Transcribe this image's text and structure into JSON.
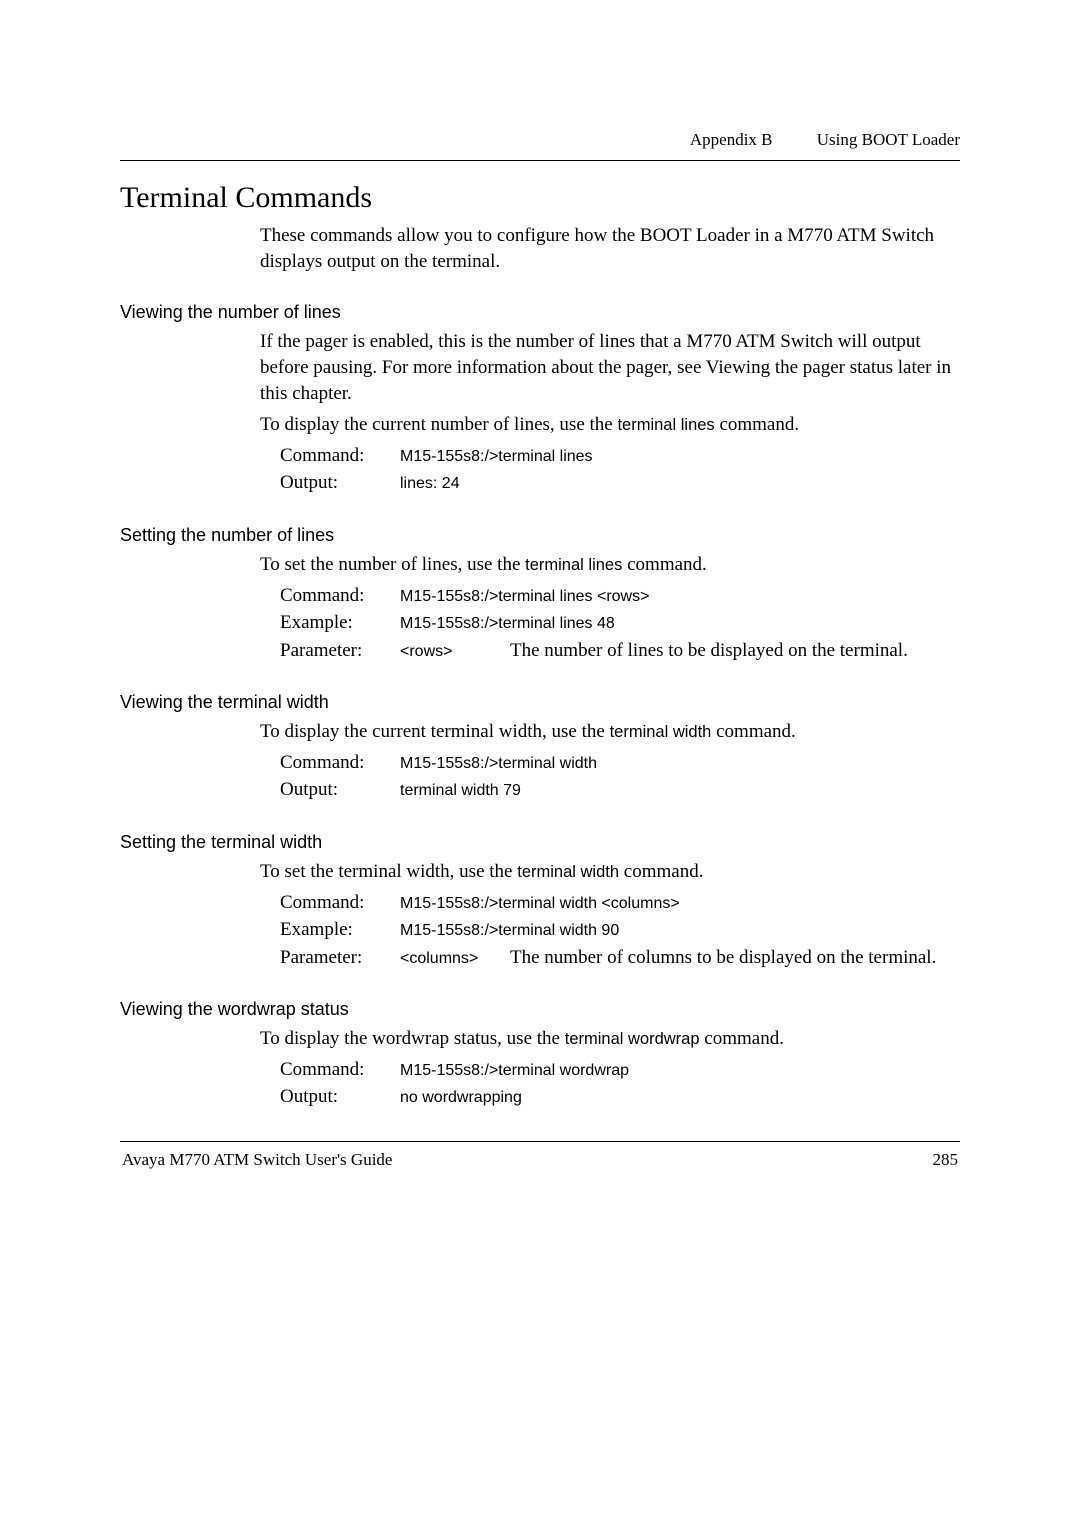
{
  "header": {
    "appendix": "Appendix B",
    "title": "Using BOOT Loader"
  },
  "section_title": "Terminal Commands",
  "intro": "These commands allow you to configure how the BOOT Loader in a M770 ATM Switch displays output on the terminal.",
  "viewing_lines": {
    "heading": "Viewing the number of lines",
    "para": "If the pager is enabled, this is the number of lines that a M770 ATM Switch will output before pausing. For more information about the pager, see Viewing the pager status later in this chapter.",
    "display_pre": "To display the current number of lines, use the ",
    "display_cmd": "terminal lines",
    "display_post": " command.",
    "command_label": "Command:",
    "command_val": "M15-155s8:/>terminal lines",
    "output_label": "Output:",
    "output_val": "lines: 24"
  },
  "setting_lines": {
    "heading": "Setting the number of lines",
    "set_pre": "To set the number of lines, use the ",
    "set_cmd": "terminal lines",
    "set_post": " command.",
    "command_label": "Command:",
    "command_val": "M15-155s8:/>terminal lines <rows>",
    "example_label": "Example:",
    "example_val": "M15-155s8:/>terminal lines 48",
    "param_label": "Parameter:",
    "param_token": "<rows>",
    "param_desc": "The number of lines to be displayed on the terminal."
  },
  "viewing_width": {
    "heading": "Viewing the terminal width",
    "display_pre": "To display the current terminal width, use the ",
    "display_cmd": "terminal width",
    "display_post": " command.",
    "command_label": "Command:",
    "command_val": "M15-155s8:/>terminal width",
    "output_label": "Output:",
    "output_val": "terminal width 79"
  },
  "setting_width": {
    "heading": "Setting the terminal width",
    "set_pre": "To set the terminal width, use the ",
    "set_cmd": "terminal width",
    "set_post": " command.",
    "command_label": "Command:",
    "command_val": "M15-155s8:/>terminal width <columns>",
    "example_label": "Example:",
    "example_val": "M15-155s8:/>terminal width 90",
    "param_label": "Parameter:",
    "param_token": "<columns>",
    "param_desc": "The number of columns to be displayed on the terminal."
  },
  "viewing_wordwrap": {
    "heading": "Viewing the wordwrap status",
    "display_pre": "To display the wordwrap status, use the ",
    "display_cmd": "terminal wordwrap",
    "display_post": " command.",
    "command_label": "Command:",
    "command_val": "M15-155s8:/>terminal wordwrap",
    "output_label": "Output:",
    "output_val": "no wordwrapping"
  },
  "footer": {
    "left": "Avaya M770 ATM Switch User's Guide",
    "right": "285"
  }
}
